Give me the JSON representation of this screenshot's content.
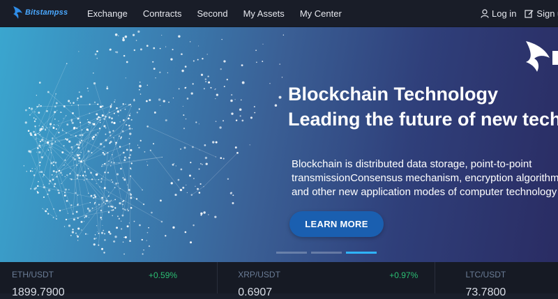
{
  "brand": {
    "name": "Bitstampss"
  },
  "nav": {
    "items": [
      {
        "label": "Exchange"
      },
      {
        "label": "Contracts"
      },
      {
        "label": "Second"
      },
      {
        "label": "My Assets"
      },
      {
        "label": "My Center"
      }
    ],
    "login_label": "Log in",
    "signup_label": "Sign up"
  },
  "hero": {
    "title_line1": "Blockchain Technology",
    "title_line2": "Leading the future of new tech",
    "desc_line1": "Blockchain is distributed data storage, point-to-point",
    "desc_line2": "transmissionConsensus mechanism, encryption algorithm",
    "desc_line3": "and other new application modes of computer technology",
    "button_label": "LEARN MORE",
    "slides": 3,
    "active_slide": 3
  },
  "ticker": [
    {
      "pair": "ETH/USDT",
      "change": "+0.59%",
      "price": "1899.7900"
    },
    {
      "pair": "XRP/USDT",
      "change": "+0.97%",
      "price": "0.6907"
    },
    {
      "pair": "LTC/USDT",
      "change": "",
      "price": "73.7800"
    }
  ],
  "colors": {
    "accent": "#2fb4ff",
    "positive": "#2bbf73",
    "button": "#1a5fb0",
    "nav_bg": "#191d28"
  }
}
